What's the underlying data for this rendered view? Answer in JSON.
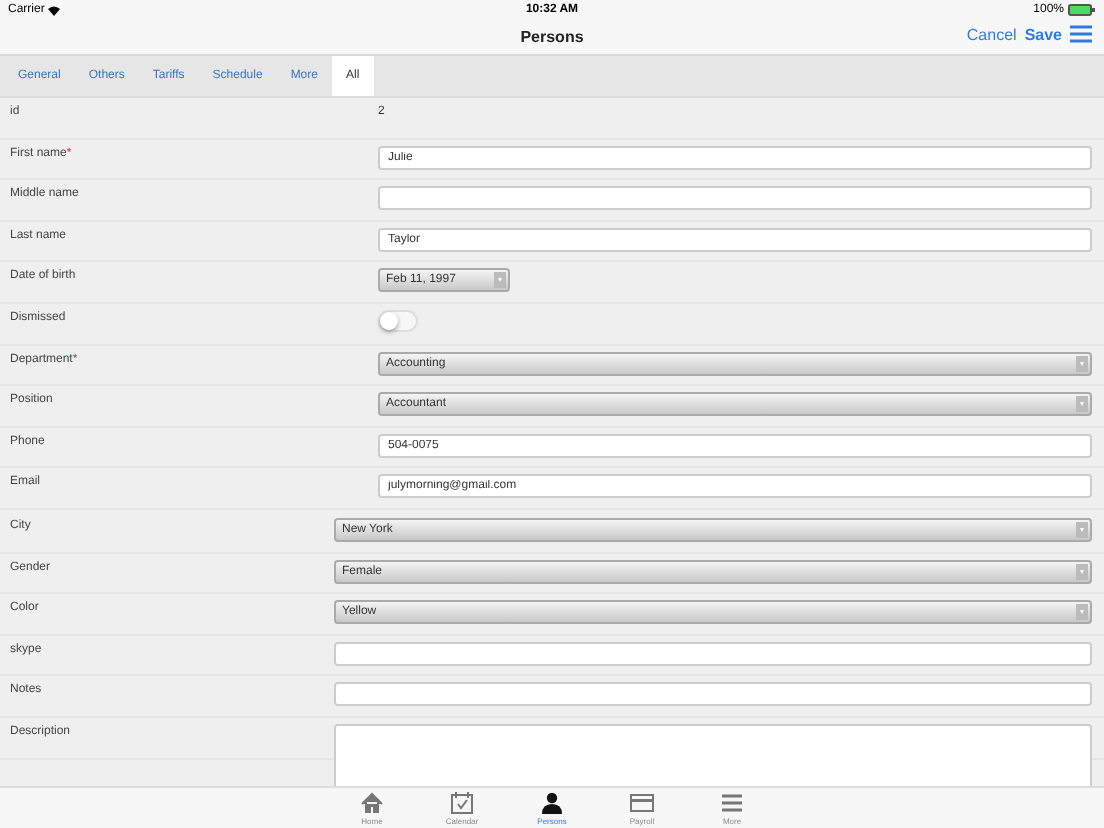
{
  "status_bar": {
    "carrier": "Carrier",
    "time": "10:32 AM",
    "battery": "100%"
  },
  "nav": {
    "title": "Persons",
    "actions": [
      "Cancel",
      "Save"
    ]
  },
  "tabs": [
    {
      "label": "General",
      "selected": false
    },
    {
      "label": "Others",
      "selected": false
    },
    {
      "label": "Tariffs",
      "selected": false
    },
    {
      "label": "Schedule",
      "selected": false
    },
    {
      "label": "More",
      "selected": false
    },
    {
      "label": "All",
      "selected": true
    }
  ],
  "sections": [
    {
      "kind": "narrow",
      "fields": [
        {
          "label": "id",
          "kind": "text",
          "value": "2"
        },
        {
          "label": "First name",
          "required_mark": "*",
          "kind": "input",
          "value": "Julie"
        },
        {
          "label": "Middle name",
          "kind": "input"
        },
        {
          "label": "Last name",
          "kind": "input",
          "value": "Taylor"
        },
        {
          "label": "Date of birth",
          "kind": "date",
          "value": "Feb 11, 1997"
        },
        {
          "label": "Dismissed",
          "kind": "toggle",
          "on": false
        },
        {
          "label": "Department",
          "required_mark": "*",
          "kind": "select",
          "value": "Accounting"
        },
        {
          "label": "Position",
          "kind": "select",
          "value": "Accountant"
        },
        {
          "label": "Phone",
          "kind": "input",
          "value": "504-0075"
        },
        {
          "label": "Email",
          "kind": "input",
          "value": "julymorning@gmail.com"
        }
      ]
    },
    {
      "kind": "wide",
      "fields": [
        {
          "label": "City",
          "kind": "select",
          "value": "New York"
        },
        {
          "label": "Gender",
          "kind": "select",
          "value": "Female"
        },
        {
          "label": "Color",
          "kind": "select",
          "value": "Yellow"
        },
        {
          "label": "skype",
          "kind": "input"
        },
        {
          "label": "Notes",
          "kind": "input"
        },
        {
          "label": "Description",
          "kind": "textarea"
        }
      ]
    }
  ],
  "tab_bar": [
    {
      "label": "Home",
      "kind": "home",
      "selected": false
    },
    {
      "label": "Calendar",
      "kind": "calendar",
      "selected": false
    },
    {
      "label": "Persons",
      "kind": "person",
      "selected": true
    },
    {
      "label": "Payroll",
      "kind": "card",
      "selected": false
    },
    {
      "label": "More",
      "kind": "lines",
      "selected": false
    }
  ]
}
